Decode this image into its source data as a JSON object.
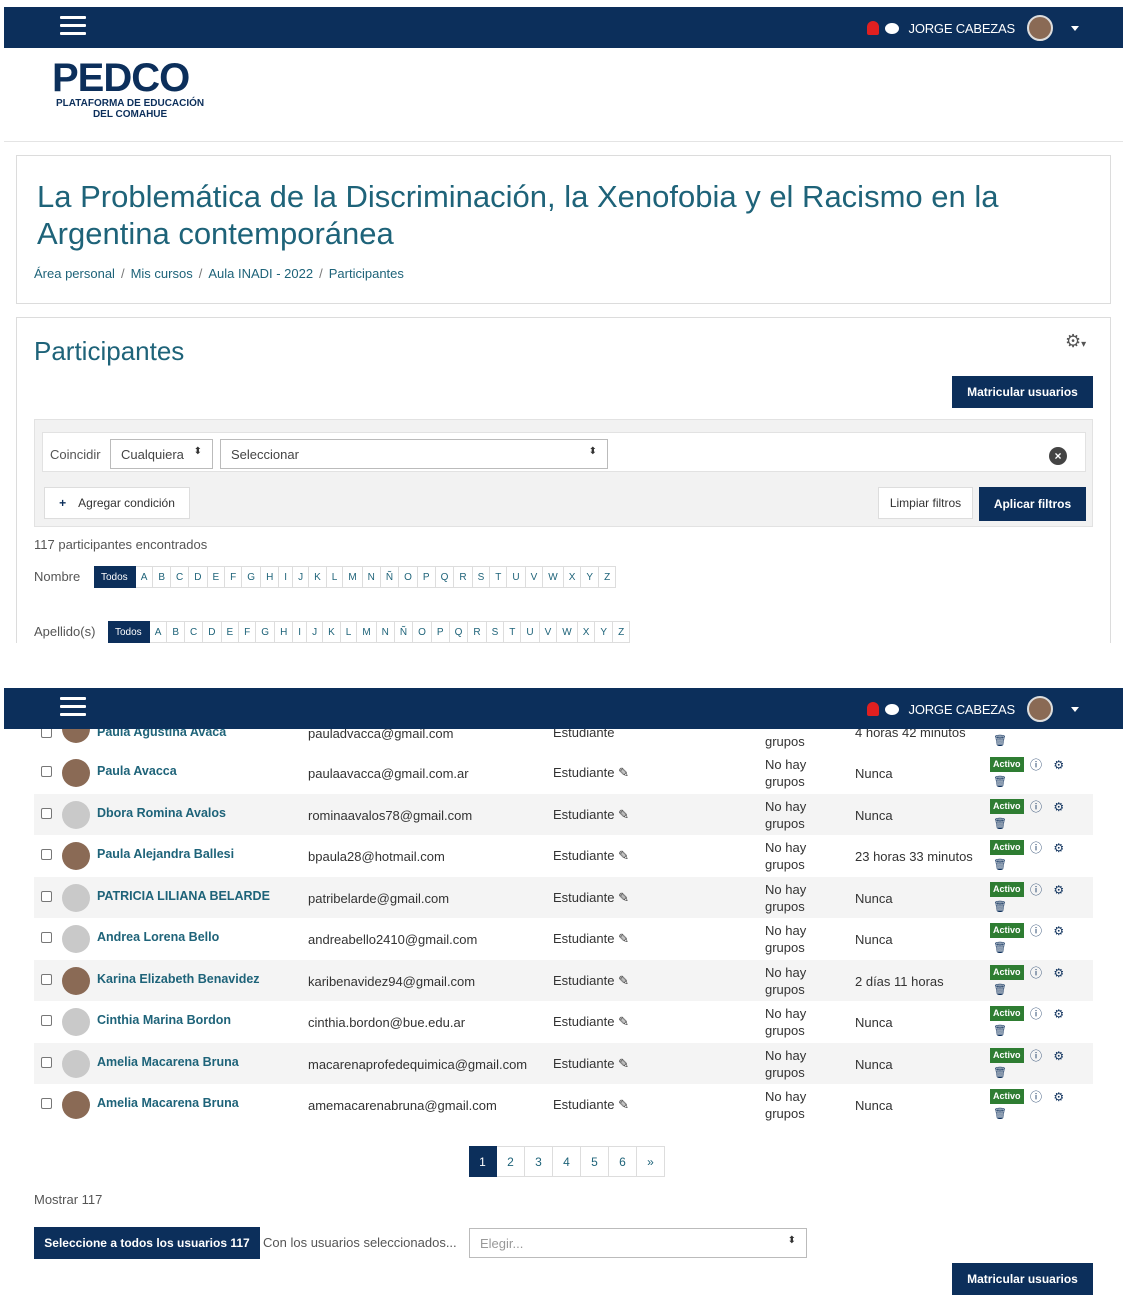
{
  "user": {
    "name": "JORGE CABEZAS"
  },
  "logo": {
    "name": "PEDCO",
    "subtitle_1": "PLATAFORMA DE EDUCACIÓN",
    "subtitle_2": "DEL COMAHUE"
  },
  "course": {
    "title": "La Problemática de la Discriminación, la Xenofobia y el Racismo en la Argentina contemporánea",
    "breadcrumbs": [
      "Área personal",
      "Mis cursos",
      "Aula INADI - 2022",
      "Participantes"
    ]
  },
  "participants": {
    "heading": "Participantes",
    "enrol_button": "Matricular usuarios",
    "filter": {
      "match_label": "Coincidir",
      "match_value": "Cualquiera",
      "select_value": "Seleccionar",
      "add_condition": "Agregar condición",
      "clear": "Limpiar filtros",
      "apply": "Aplicar filtros"
    },
    "count_text": "117 participantes encontrados",
    "firstname_label": "Nombre",
    "lastname_label": "Apellido(s)",
    "todos": "Todos",
    "letters": [
      "A",
      "B",
      "C",
      "D",
      "E",
      "F",
      "G",
      "H",
      "I",
      "J",
      "K",
      "L",
      "M",
      "N",
      "Ñ",
      "O",
      "P",
      "Q",
      "R",
      "S",
      "T",
      "U",
      "V",
      "W",
      "X",
      "Y",
      "Z"
    ]
  },
  "partial_row": {
    "name": "Paula Agustina Avaca",
    "email": "pauladvacca@gmail.com",
    "role": "Estudiante",
    "groups_line2": "grupos",
    "last": "4 horas 42 minutos"
  },
  "rows": [
    {
      "name": "Paula Avacca",
      "email": "paulaavacca@gmail.com.ar",
      "role": "Estudiante",
      "groups": [
        "No hay",
        "grupos"
      ],
      "last": "Nunca",
      "status": "Activo",
      "photo": true
    },
    {
      "name": "Dbora Romina Avalos",
      "email": "rominaavalos78@gmail.com",
      "role": "Estudiante",
      "groups": [
        "No hay",
        "grupos"
      ],
      "last": "Nunca",
      "status": "Activo",
      "photo": false
    },
    {
      "name": "Paula Alejandra Ballesi",
      "email": "bpaula28@hotmail.com",
      "role": "Estudiante",
      "groups": [
        "No hay",
        "grupos"
      ],
      "last": "23 horas 33 minutos",
      "status": "Activo",
      "photo": true
    },
    {
      "name": "PATRICIA LILIANA BELARDE",
      "email": "patribelarde@gmail.com",
      "role": "Estudiante",
      "groups": [
        "No hay",
        "grupos"
      ],
      "last": "Nunca",
      "status": "Activo",
      "photo": false
    },
    {
      "name": "Andrea Lorena Bello",
      "email": "andreabello2410@gmail.com",
      "role": "Estudiante",
      "groups": [
        "No hay",
        "grupos"
      ],
      "last": "Nunca",
      "status": "Activo",
      "photo": false
    },
    {
      "name": "Karina Elizabeth Benavidez",
      "email": "karibenavidez94@gmail.com",
      "role": "Estudiante",
      "groups": [
        "No hay",
        "grupos"
      ],
      "last": "2 días 11 horas",
      "status": "Activo",
      "photo": true
    },
    {
      "name": "Cinthia Marina Bordon",
      "email": "cinthia.bordon@bue.edu.ar",
      "role": "Estudiante",
      "groups": [
        "No hay",
        "grupos"
      ],
      "last": "Nunca",
      "status": "Activo",
      "photo": false
    },
    {
      "name": "Amelia Macarena Bruna",
      "email": "macarenaprofedequimica@gmail.com",
      "role": "Estudiante",
      "groups": [
        "No hay",
        "grupos"
      ],
      "last": "Nunca",
      "status": "Activo",
      "photo": false
    },
    {
      "name": "Amelia Macarena Bruna",
      "email": "amemacarenabruna@gmail.com",
      "role": "Estudiante",
      "groups": [
        "No hay",
        "grupos"
      ],
      "last": "Nunca",
      "status": "Activo",
      "photo": true
    }
  ],
  "pagination": {
    "pages": [
      "1",
      "2",
      "3",
      "4",
      "5",
      "6",
      "»"
    ],
    "current": "1"
  },
  "footer": {
    "show_all": "Mostrar 117",
    "select_all": "Seleccione a todos los usuarios 117",
    "with_selected": "Con los usuarios seleccionados...",
    "choose_placeholder": "Elegir...",
    "enrol_button": "Matricular usuarios"
  },
  "colors": {
    "navbar": "#0c2f5b",
    "link": "#1e6379",
    "status": "#2e7d32"
  }
}
